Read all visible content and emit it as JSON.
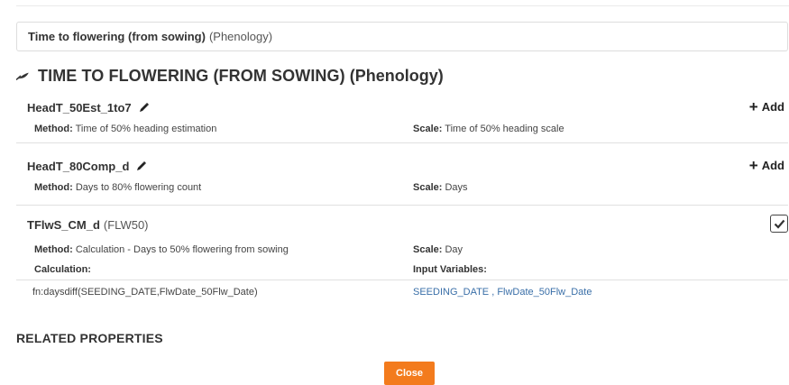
{
  "header": {
    "bold_label": "Time to flowering (from sowing)",
    "light_label": "(Phenology)"
  },
  "section_title": {
    "main": "TIME TO FLOWERING (FROM SOWING)",
    "sub": "(Phenology)",
    "icon": "leaf-icon"
  },
  "variables": [
    {
      "name": "HeadT_50Est_1to7",
      "editable": true,
      "action": "Add",
      "method_label": "Method:",
      "method": "Time of 50% heading estimation",
      "scale_label": "Scale:",
      "scale": "Time of 50% heading scale"
    },
    {
      "name": "HeadT_80Comp_d",
      "editable": true,
      "action": "Add",
      "method_label": "Method:",
      "method": "Days to 80% flowering count",
      "scale_label": "Scale:",
      "scale": "Days"
    },
    {
      "name": "TFlwS_CM_d",
      "alias": "(FLW50)",
      "checked": true,
      "method_label": "Method:",
      "method": "Calculation - Days to 50% flowering from sowing",
      "scale_label": "Scale:",
      "scale": "Day",
      "calculation_label": "Calculation:",
      "input_variables_label": "Input Variables:",
      "calculation": "fn:daysdiff(SEEDING_DATE,FlwDate_50Flw_Date)",
      "input_variables": "SEEDING_DATE , FlwDate_50Flw_Date"
    }
  ],
  "related_properties": "RELATED PROPERTIES",
  "close_label": "Close",
  "colors": {
    "accent_orange": "#f37b1d",
    "link_blue": "#3a6fa8",
    "text": "#333333",
    "border": "#dddddd"
  }
}
